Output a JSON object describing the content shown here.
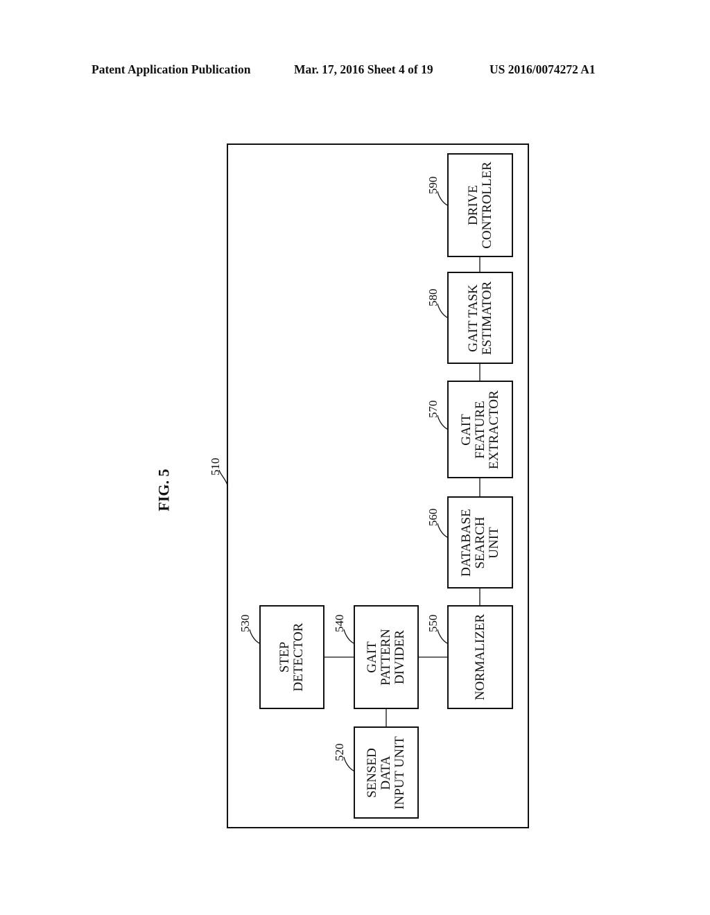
{
  "header": {
    "left": "Patent Application Publication",
    "middle": "Mar. 17, 2016  Sheet 4 of 19",
    "right": "US 2016/0074272 A1"
  },
  "figure": {
    "title": "FIG. 5",
    "container_ref": "510",
    "blocks": [
      {
        "ref": "520",
        "lines": [
          "SENSED",
          "DATA",
          "INPUT UNIT"
        ]
      },
      {
        "ref": "530",
        "lines": [
          "STEP",
          "DETECTOR"
        ]
      },
      {
        "ref": "540",
        "lines": [
          "GAIT",
          "PATTERN",
          "DIVIDER"
        ]
      },
      {
        "ref": "550",
        "lines": [
          "NORMALIZER"
        ]
      },
      {
        "ref": "560",
        "lines": [
          "DATABASE",
          "SEARCH",
          "UNIT"
        ]
      },
      {
        "ref": "570",
        "lines": [
          "GAIT",
          "FEATURE",
          "EXTRACTOR"
        ]
      },
      {
        "ref": "580",
        "lines": [
          "GAIT TASK",
          "ESTIMATOR"
        ]
      },
      {
        "ref": "590",
        "lines": [
          "DRIVE",
          "CONTROLLER"
        ]
      }
    ],
    "connections": [
      [
        "520",
        "540"
      ],
      [
        "530",
        "540"
      ],
      [
        "540",
        "550"
      ],
      [
        "550",
        "560"
      ],
      [
        "560",
        "570"
      ],
      [
        "570",
        "580"
      ],
      [
        "580",
        "590"
      ]
    ]
  }
}
